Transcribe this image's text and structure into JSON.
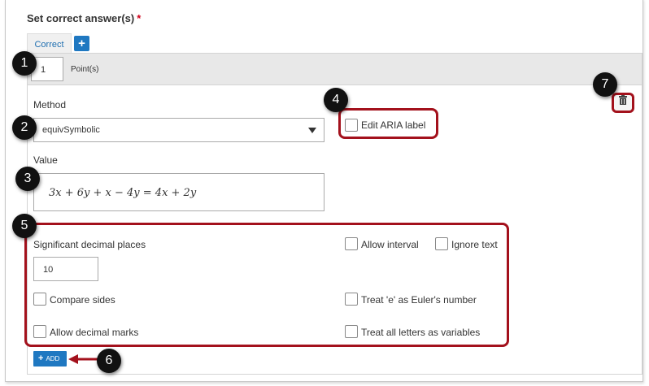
{
  "title": "Set correct answer(s)",
  "required_mark": "*",
  "tabs": [
    {
      "label": "Correct"
    }
  ],
  "add_tab_label": "+",
  "points": {
    "value": "1",
    "label": "Point(s)"
  },
  "method": {
    "label": "Method",
    "value": "equivSymbolic"
  },
  "edit_aria_label": "Edit ARIA label",
  "value": {
    "label": "Value",
    "expression": "3x + 6y + x − 4y = 4x + 2y"
  },
  "options": {
    "significant_decimal_label": "Significant decimal places",
    "significant_decimal_value": "10",
    "allow_interval": "Allow interval",
    "ignore_text": "Ignore text",
    "compare_sides": "Compare sides",
    "treat_e": "Treat 'e' as Euler's number",
    "allow_decimal_marks": "Allow decimal marks",
    "treat_letters": "Treat all letters as variables"
  },
  "add_button": {
    "icon": "+",
    "label": "ADD"
  },
  "callouts": [
    "1",
    "2",
    "3",
    "4",
    "5",
    "6",
    "7"
  ],
  "accent_color": "#1f78c1",
  "highlight_color": "#a3111c"
}
